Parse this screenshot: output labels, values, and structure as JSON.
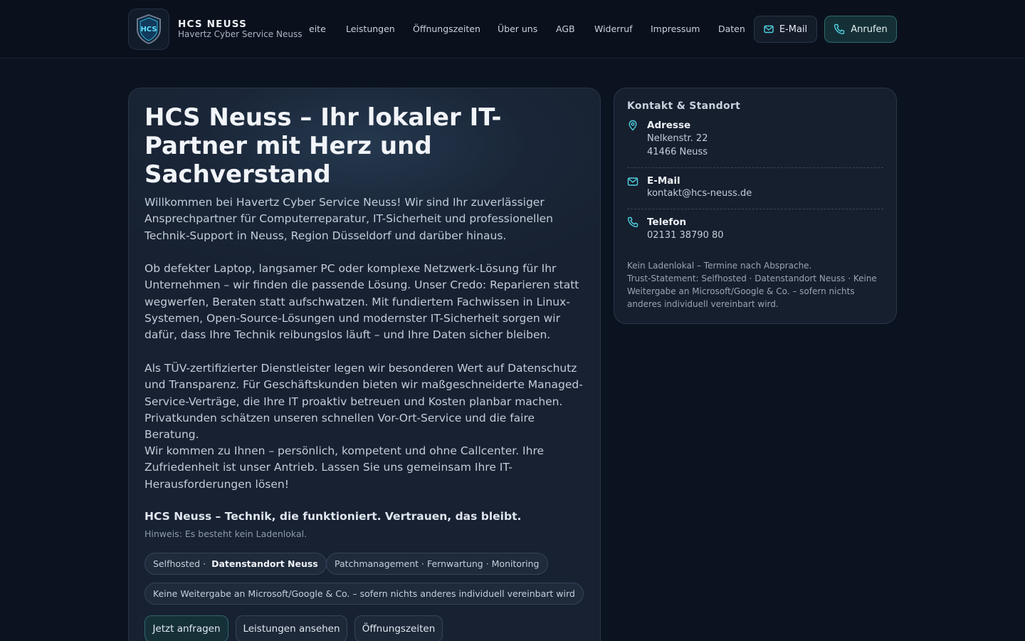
{
  "header": {
    "brand_title": "HCS NEUSS",
    "brand_subtitle": "Havertz Cyber Service Neuss",
    "logo_text": "HCS",
    "nav": [
      "eite",
      "Leistungen",
      "Öffnungszeiten",
      "Über uns",
      "AGB",
      "Widerruf",
      "Impressum",
      "Daten"
    ],
    "email_label": "E-Mail",
    "call_label": "Anrufen"
  },
  "hero": {
    "title": "HCS Neuss – Ihr lokaler IT-Partner mit Herz und Sachverstand",
    "paragraphs": [
      "Willkommen bei Havertz Cyber Service Neuss! Wir sind Ihr zuverlässiger Ansprechpartner für Computerreparatur, IT-Sicherheit und professionellen Technik-Support in Neuss, Region Düsseldorf und darüber hinaus.",
      "Ob defekter Laptop, langsamer PC oder komplexe Netzwerk-Lösung für Ihr Unternehmen – wir finden die passende Lösung. Unser Credo: Reparieren statt wegwerfen, Beraten statt aufschwatzen. Mit fundiertem Fachwissen in Linux-Systemen, Open-Source-Lösungen und modernster IT-Sicherheit sorgen wir dafür, dass Ihre Technik reibungslos läuft – und Ihre Daten sicher bleiben.",
      "Als TÜV-zertifizierter Dienstleister legen wir besonderen Wert auf Datenschutz und Transparenz. Für Geschäftskunden bieten wir maßgeschneiderte Managed-Service-Verträge, die Ihre IT proaktiv betreuen und Kosten planbar machen. Privatkunden schätzen unseren schnellen Vor-Ort-Service und die faire Beratung.",
      "Wir kommen zu Ihnen – persönlich, kompetent und ohne Callcenter. Ihre Zufriedenheit ist unser Antrieb. Lassen Sie uns gemeinsam Ihre IT-Herausforderungen lösen!"
    ],
    "slogan": "HCS Neuss – Technik, die funktioniert. Vertrauen, das bleibt.",
    "hint": "Hinweis: Es besteht kein Ladenlokal.",
    "chips": {
      "selfhosted_prefix": "Selfhosted ·",
      "selfhosted_bold": "Datenstandort Neuss",
      "patch": "Patchmanagement · Fernwartung · Monitoring",
      "no_share": "Keine Weitergabe an Microsoft/Google & Co. – sofern nichts anderes individuell vereinbart wird"
    },
    "buttons": {
      "request": "Jetzt anfragen",
      "services": "Leistungen ansehen",
      "hours": "Öffnungszeiten"
    }
  },
  "contact": {
    "title": "Kontakt & Standort",
    "address_label": "Adresse",
    "address_line1": "Nelkenstr. 22",
    "address_line2": "41466 Neuss",
    "email_label": "E-Mail",
    "email_value": "kontakt@hcs-neuss.de",
    "phone_label": "Telefon",
    "phone_value": "02131 38790 80",
    "note_1": "Kein Ladenlokal – Termine nach Absprache.",
    "note_2": "Trust-Statement: Selfhosted · Datenstandort Neuss · Keine Weitergabe an Microsoft/Google & Co. – sofern nichts anderes individuell vereinbart wird."
  },
  "colors": {
    "background": "#0b1220",
    "accent_teal": "#4fd1e0",
    "call_button_bg": "#143036"
  }
}
